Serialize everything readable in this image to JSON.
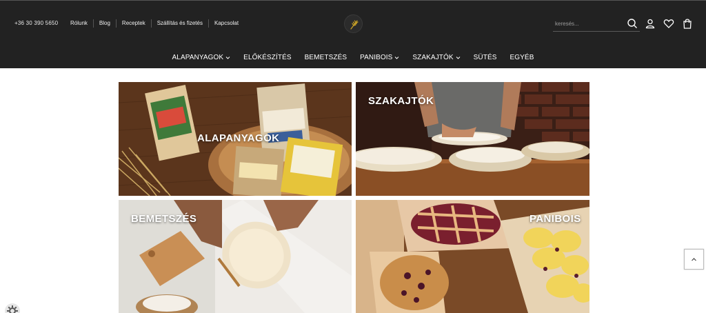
{
  "header": {
    "phone": "+36 30 390 5650",
    "links": [
      "Rólunk",
      "Blog",
      "Receptek",
      "Szállítás és fizetés",
      "Kapcsolat"
    ],
    "search_placeholder": "keresés...",
    "icons": [
      "search-icon",
      "user-icon",
      "heart-icon",
      "cart-icon"
    ]
  },
  "nav": {
    "items": [
      {
        "label": "ALAPANYAGOK",
        "dropdown": true
      },
      {
        "label": "ELŐKÉSZÍTÉS",
        "dropdown": false
      },
      {
        "label": "BEMETSZÉS",
        "dropdown": false
      },
      {
        "label": "PANIBOIS",
        "dropdown": true
      },
      {
        "label": "SZAKAJTÓK",
        "dropdown": true
      },
      {
        "label": "SÜTÉS",
        "dropdown": false
      },
      {
        "label": "EGYÉB",
        "dropdown": false
      }
    ]
  },
  "categories": [
    {
      "label": "ALAPANYAGOK"
    },
    {
      "label": "SZAKAJTÓK"
    },
    {
      "label": "BEMETSZÉS"
    },
    {
      "label": "PANIBOIS"
    }
  ],
  "colors": {
    "header_bg": "#222222",
    "accent": "#c9a227"
  }
}
